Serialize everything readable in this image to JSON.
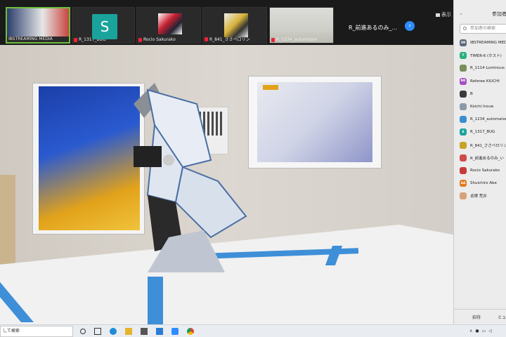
{
  "strip": {
    "thumbnails": [
      {
        "name": "R_1317_BUG",
        "avatar_letter": "S"
      },
      {
        "name": "Rocio Sakurako"
      },
      {
        "name": "R_841_ささペロリン"
      },
      {
        "name": "R_1234_automaton"
      }
    ],
    "first_thumb_label": "IBSTREAMING MEDIA",
    "active_speaker": "R_前進あるのみ_...",
    "view_label": "表示"
  },
  "panel": {
    "title": "参加者",
    "search_placeholder": "参加者の検索",
    "participants": [
      {
        "initials": "IM",
        "name": "IBSTREAMING MEDI",
        "color": "#5a6b7c"
      },
      {
        "initials": "T",
        "name": "TIMER-6 (ホスト)",
        "color": "#2bb07a"
      },
      {
        "initials": "",
        "name": "R_1114 Luminous",
        "color": "#7a8f5a"
      },
      {
        "initials": "RK",
        "name": "Referee KIUCHI",
        "color": "#a44fc1"
      },
      {
        "initials": "",
        "name": "B",
        "color": "#3a3a3a"
      },
      {
        "initials": "",
        "name": "Koichi Inoue",
        "color": "#8c9aa8"
      },
      {
        "initials": "",
        "name": "R_1234_automaton",
        "color": "#3a8fd0"
      },
      {
        "initials": "S",
        "name": "R_1317_BUG",
        "color": "#1aa39b"
      },
      {
        "initials": "",
        "name": "R_841_ささペロリン",
        "color": "#c9a227"
      },
      {
        "initials": "",
        "name": "R_前進あるのみ_い",
        "color": "#d04a4a"
      },
      {
        "initials": "",
        "name": "Rocio Sakurako",
        "color": "#c73a3a"
      },
      {
        "initials": "SA",
        "name": "Shuichiro Abe",
        "color": "#e07a1f"
      },
      {
        "initials": "",
        "name": "貞博 荒井",
        "color": "#d9a079"
      }
    ],
    "invite_label": "招待",
    "mute_label": "ミュ"
  },
  "taskbar": {
    "search_text": "して検索"
  },
  "colors": {
    "zoom_blue": "#2d8cff",
    "active_green": "#6fbf3f",
    "tape_blue": "#3e8fd8"
  }
}
